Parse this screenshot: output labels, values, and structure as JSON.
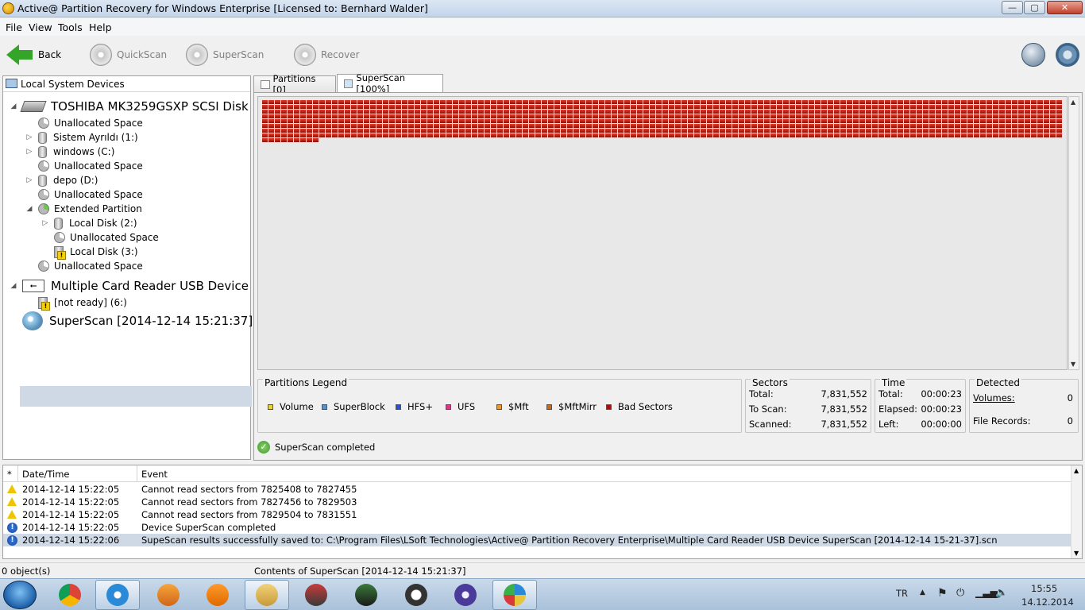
{
  "window": {
    "title": "Active@ Partition Recovery for Windows Enterprise [Licensed to: Bernhard Walder]",
    "controls": {
      "minimize": "—",
      "maximize": "▢",
      "close": "✕"
    }
  },
  "menu": [
    "File",
    "View",
    "Tools",
    "Help"
  ],
  "toolbar": {
    "back": "Back",
    "quickscan": "QuickScan",
    "superscan": "SuperScan",
    "recover": "Recover"
  },
  "left_panel": {
    "header": "Local System Devices",
    "tree": [
      {
        "label": "TOSHIBA MK3259GSXP SCSI Disk ...",
        "icon": "hdd-icon",
        "twisty": "◢"
      },
      {
        "label": "Unallocated Space",
        "icon": "pie-icon",
        "twisty": ""
      },
      {
        "label": "Sistem Ayrıldı (1:)",
        "icon": "disk-icon",
        "twisty": "▷"
      },
      {
        "label": "windows (C:)",
        "icon": "disk-icon",
        "twisty": "▷"
      },
      {
        "label": "Unallocated Space",
        "icon": "pie-icon",
        "twisty": ""
      },
      {
        "label": "depo (D:)",
        "icon": "disk-icon",
        "twisty": "▷"
      },
      {
        "label": "Unallocated Space",
        "icon": "pie-icon",
        "twisty": ""
      },
      {
        "label": "Extended Partition",
        "icon": "pie-green-icon",
        "twisty": "◢"
      },
      {
        "label": "Local Disk (2:)",
        "icon": "disk-icon",
        "twisty": "▷"
      },
      {
        "label": "Unallocated Space",
        "icon": "pie-icon",
        "twisty": ""
      },
      {
        "label": "Local Disk (3:)",
        "icon": "disk-warning-icon",
        "twisty": ""
      },
      {
        "label": "Unallocated Space",
        "icon": "pie-icon",
        "twisty": ""
      },
      {
        "label": "Multiple Card  Reader USB Device",
        "icon": "usb-icon",
        "twisty": "◢"
      },
      {
        "label": "[not ready] (6:)",
        "icon": "disk-warning-icon",
        "twisty": ""
      },
      {
        "label": "SuperScan [2014-12-14 15:21:37]",
        "icon": "superscan-icon",
        "twisty": ""
      }
    ]
  },
  "tabs": [
    {
      "label": "Partitions [0]",
      "active": false
    },
    {
      "label": "SuperScan [100%]",
      "active": true
    }
  ],
  "scan": {
    "progress_percent": 100,
    "blocks_color": "#c41e12"
  },
  "legend": {
    "title": "Partitions Legend",
    "items": [
      {
        "label": "Volume",
        "color": "#e8d040"
      },
      {
        "label": "SuperBlock",
        "color": "#5a8fc8"
      },
      {
        "label": "HFS+",
        "color": "#2a4fd8"
      },
      {
        "label": "UFS",
        "color": "#d83a8a"
      },
      {
        "label": "$Mft",
        "color": "#e89a3a"
      },
      {
        "label": "$MftMirr",
        "color": "#c86a1a"
      },
      {
        "label": "Bad Sectors",
        "color": "#a81010"
      }
    ]
  },
  "sectors": {
    "title": "Sectors",
    "total_label": "Total:",
    "total": "7,831,552",
    "toscan_label": "To Scan:",
    "toscan": "7,831,552",
    "scanned_label": "Scanned:",
    "scanned": "7,831,552"
  },
  "time": {
    "title": "Time",
    "total_label": "Total:",
    "total": "00:00:23",
    "elapsed_label": "Elapsed:",
    "elapsed": "00:00:23",
    "left_label": "Left:",
    "left": "00:00:00"
  },
  "detected": {
    "title": "Detected",
    "volumes_label": "Volumes:",
    "volumes": "0",
    "files_label": "File Records:",
    "files": "0"
  },
  "scan_status": "SuperScan completed",
  "log": {
    "columns": [
      "*",
      "Date/Time",
      "Event"
    ],
    "rows": [
      {
        "type": "warning",
        "time": "2014-12-14 15:22:05",
        "event": "Cannot read sectors from 7825408 to 7827455"
      },
      {
        "type": "warning",
        "time": "2014-12-14 15:22:05",
        "event": "Cannot read sectors from 7827456 to 7829503"
      },
      {
        "type": "warning",
        "time": "2014-12-14 15:22:05",
        "event": "Cannot read sectors from 7829504 to 7831551"
      },
      {
        "type": "info",
        "time": "2014-12-14 15:22:05",
        "event": "Device SuperScan completed"
      },
      {
        "type": "info",
        "time": "2014-12-14 15:22:06",
        "event": "SupeScan results successfully saved to: C:\\Program Files\\LSoft Technologies\\Active@ Partition Recovery Enterprise\\Multiple Card  Reader USB Device SuperScan [2014-12-14 15-21-37].scn"
      }
    ]
  },
  "statusbar": {
    "left": "0 object(s)",
    "middle": "Contents of SuperScan [2014-12-14 15:21:37]"
  },
  "taskbar": {
    "apps": [
      "chrome-icon",
      "ie-icon",
      "outlook-icon",
      "vlc-icon",
      "explorer-icon",
      "racing-game-icon",
      "soccer-game-icon",
      "headset-icon",
      "eclipse-icon",
      "partition-recovery-icon"
    ],
    "lang": "TR",
    "time": "15:55",
    "date": "14.12.2014"
  }
}
